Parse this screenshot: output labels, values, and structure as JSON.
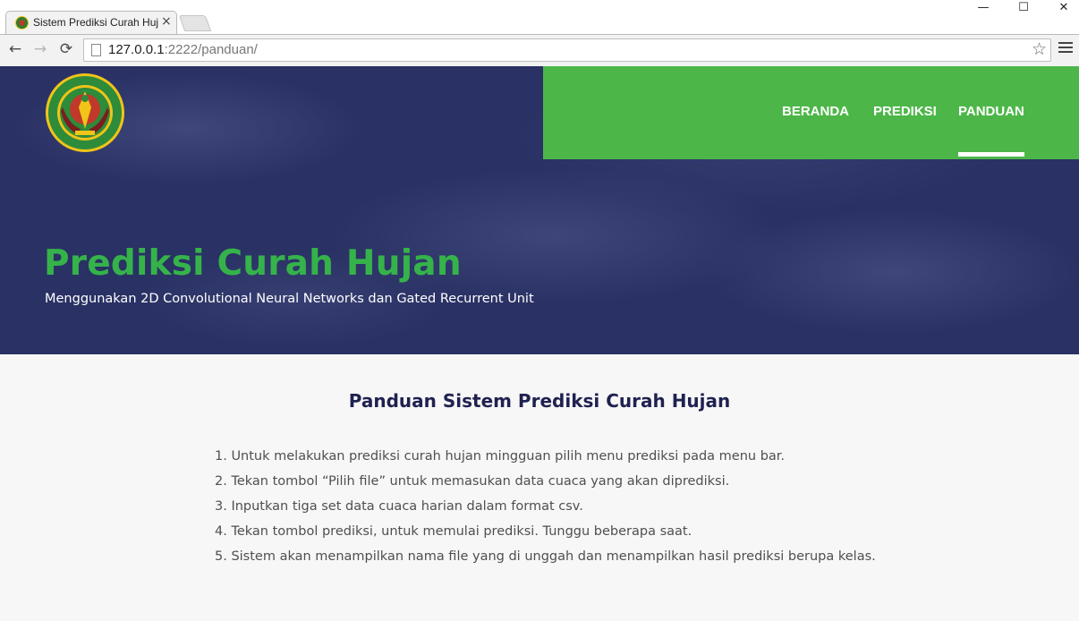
{
  "browser": {
    "tab_title": "Sistem Prediksi Curah Hujan",
    "tab_close": "×",
    "url_host": "127.0.0.1",
    "url_rest": ":2222/panduan/",
    "back_glyph": "←",
    "forward_glyph": "→",
    "reload_glyph": "⟳",
    "star_glyph": "☆",
    "minimize_glyph": "—",
    "maximize_glyph": "☐",
    "close_glyph": "✕"
  },
  "navbar": {
    "items": [
      "BERANDA",
      "PREDIKSI",
      "PANDUAN"
    ],
    "active": "PANDUAN",
    "bg_color": "#4cb748"
  },
  "hero": {
    "title": "Prediksi Curah Hujan",
    "subtitle": "Menggunakan 2D Convolutional Neural Networks dan Gated Recurrent Unit",
    "title_color": "#35b34a"
  },
  "content": {
    "title": "Panduan Sistem Prediksi Curah Hujan",
    "steps": [
      "1. Untuk melakukan prediksi curah hujan mingguan pilih menu prediksi pada menu bar.",
      "2. Tekan tombol “Pilih file” untuk memasukan data cuaca yang akan diprediksi.",
      "3. Inputkan tiga set data cuaca harian dalam format csv.",
      "4. Tekan tombol prediksi, untuk memulai prediksi. Tunggu beberapa saat.",
      "5. Sistem akan menampilkan nama file yang di unggah dan menampilkan hasil prediksi berupa kelas."
    ]
  }
}
